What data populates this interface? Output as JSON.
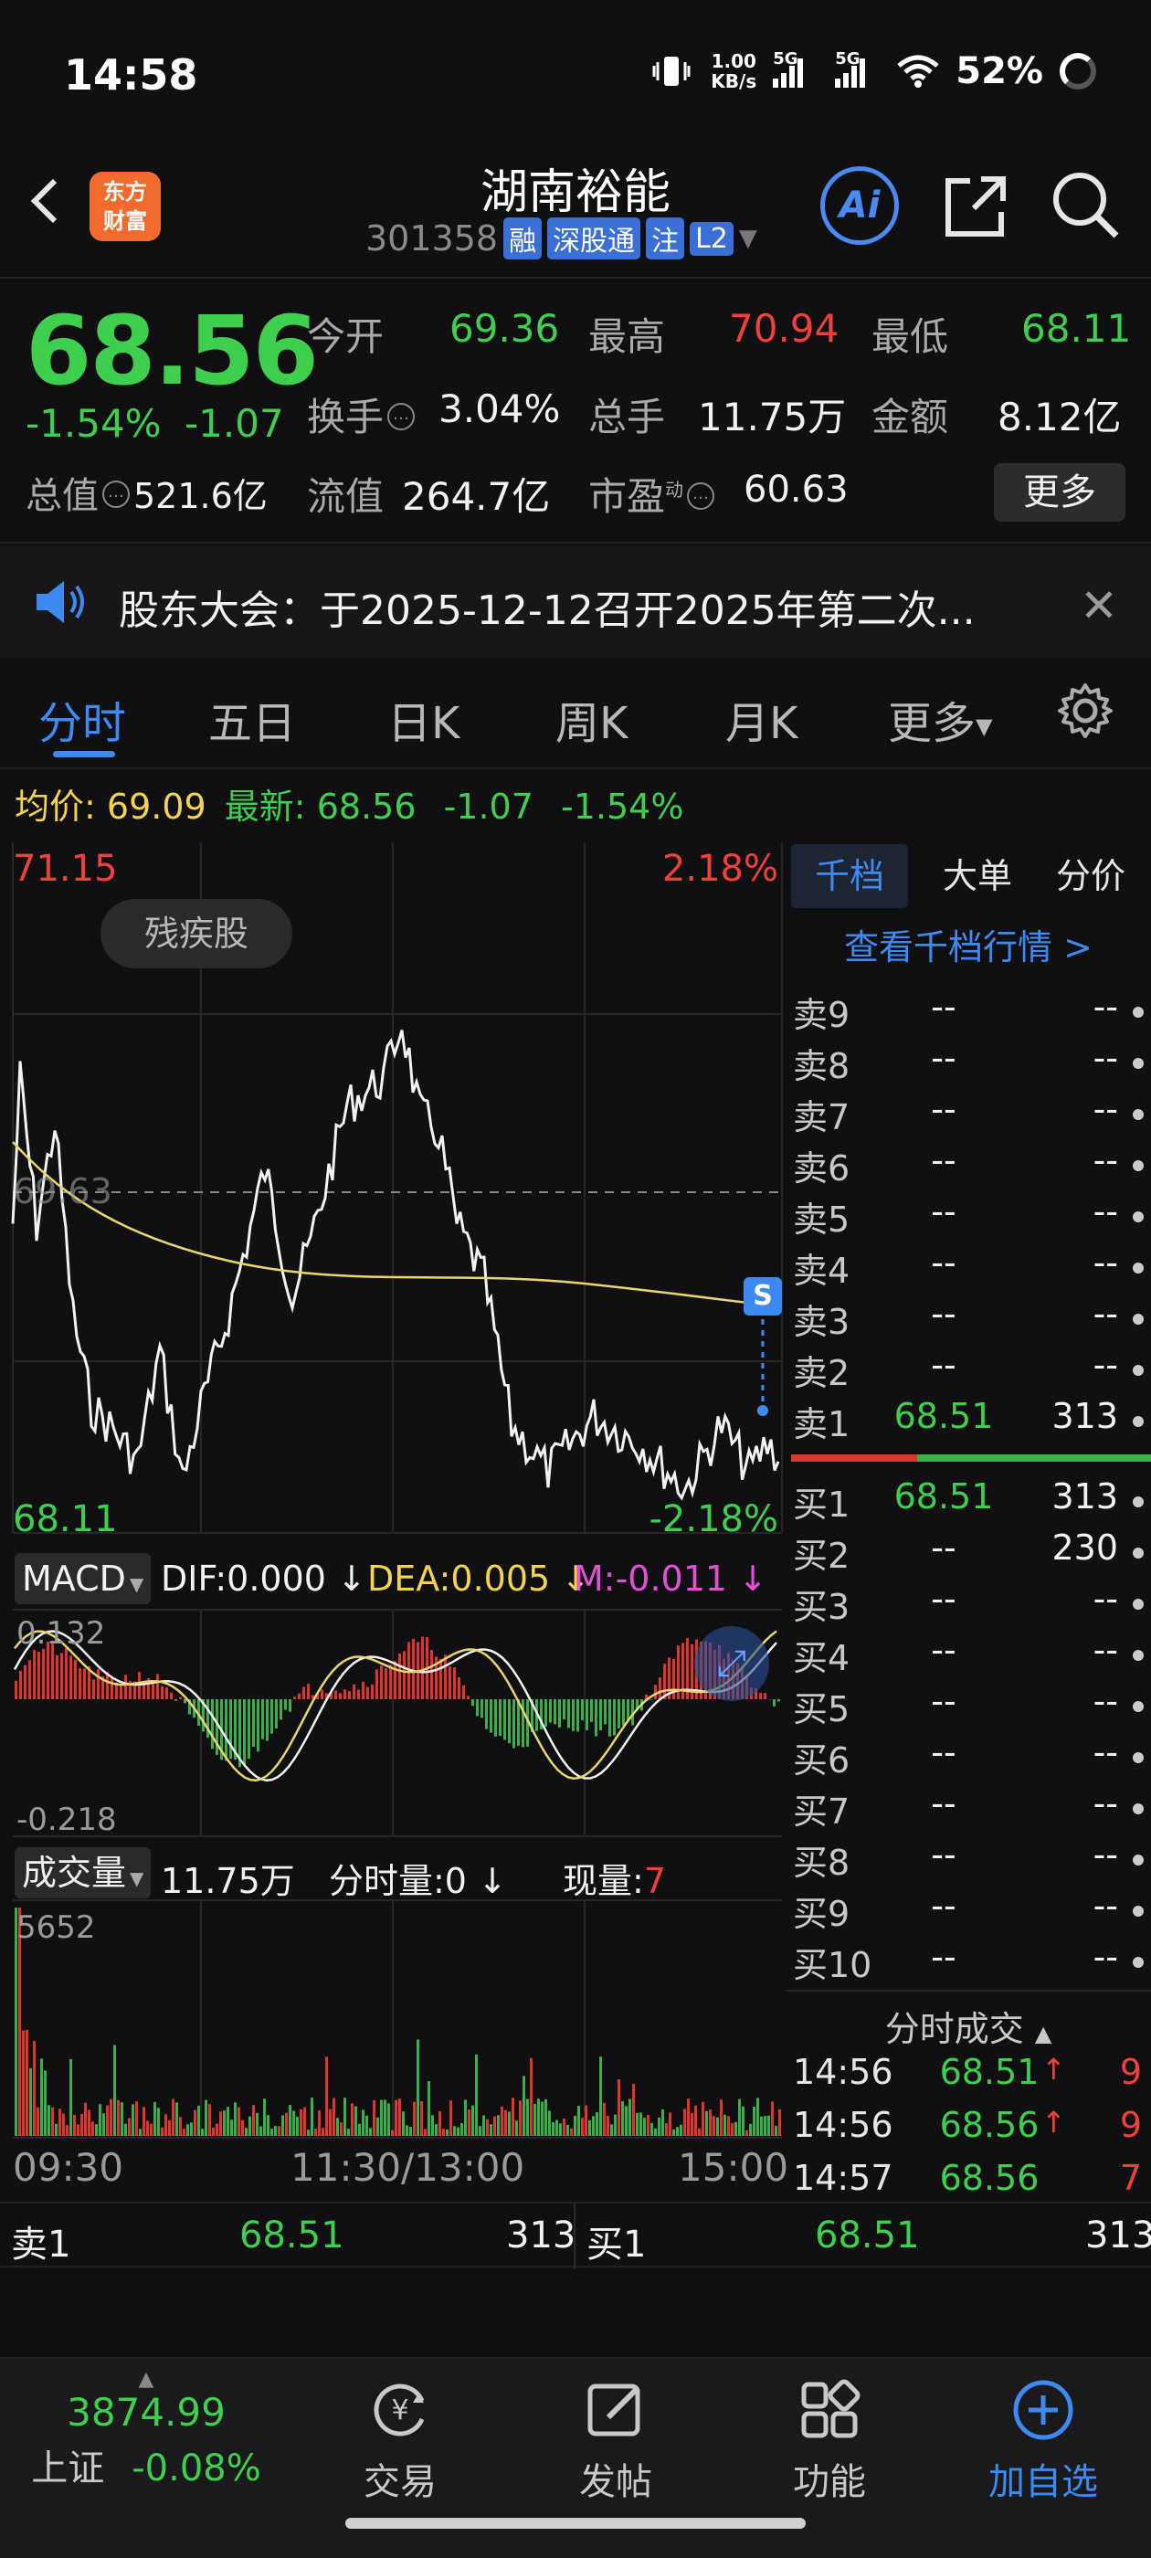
{
  "status": {
    "time": "14:58",
    "net_rate_top": "1.00",
    "net_rate_bottom": "KB/s",
    "sig1": "5G",
    "sig2": "5G",
    "battery": "52%"
  },
  "header": {
    "logo_line1": "东方",
    "logo_line2": "财富",
    "name": "湖南裕能",
    "code": "301358",
    "tags": [
      "融",
      "深股通",
      "注",
      "L2"
    ],
    "ai_label": "Ai"
  },
  "quote": {
    "price": "68.56",
    "change_pct": "-1.54%",
    "change_amt": "-1.07",
    "open_label": "今开",
    "open": "69.36",
    "high_label": "最高",
    "high": "70.94",
    "low_label": "最低",
    "low": "68.11",
    "turnover_label": "换手",
    "turnover": "3.04%",
    "volume_label": "总手",
    "volume": "11.75万",
    "amount_label": "金额",
    "amount": "8.12亿",
    "mcap_label": "总值",
    "mcap": "521.6亿",
    "float_label": "流值",
    "float_cap": "264.7亿",
    "pe_label": "市盈",
    "pe_sup": "动",
    "pe": "60.63",
    "more": "更多"
  },
  "notice": {
    "text": "股东大会：于2025-12-12召开2025年第二次..."
  },
  "tabs": [
    "分时",
    "五日",
    "日K",
    "周K",
    "月K",
    "更多"
  ],
  "avg_row": {
    "avg_label": "均价:",
    "avg": "69.09",
    "latest_label": "最新:",
    "latest": "68.56",
    "chg": "-1.07",
    "pct": "-1.54%"
  },
  "chart": {
    "y_top": "71.15",
    "y_top_pct": "2.18%",
    "y_mid": "69.63",
    "y_bottom": "68.11",
    "y_bottom_pct": "-2.18%",
    "badge": "残疾股",
    "marker": "S",
    "macd_label": "MACD",
    "dif": "DIF:0.000",
    "dea": "DEA:0.005",
    "m": "M:-0.011",
    "macd_top": "0.132",
    "macd_bottom": "-0.218",
    "vol_label": "成交量",
    "vol_total": "11.75万",
    "vol_tick_label": "分时量:0",
    "vol_now_label": "现量:",
    "vol_now": "7",
    "vol_max": "5652",
    "x_labels": [
      "09:30",
      "11:30/13:00",
      "15:00"
    ]
  },
  "orderbook": {
    "tabs": [
      "千档",
      "大单",
      "分价"
    ],
    "link": "查看千档行情 >",
    "asks": [
      {
        "label": "卖9",
        "price": "--",
        "vol": "--"
      },
      {
        "label": "卖8",
        "price": "--",
        "vol": "--"
      },
      {
        "label": "卖7",
        "price": "--",
        "vol": "--"
      },
      {
        "label": "卖6",
        "price": "--",
        "vol": "--"
      },
      {
        "label": "卖5",
        "price": "--",
        "vol": "--"
      },
      {
        "label": "卖4",
        "price": "--",
        "vol": "--"
      },
      {
        "label": "卖3",
        "price": "--",
        "vol": "--"
      },
      {
        "label": "卖2",
        "price": "--",
        "vol": "--"
      },
      {
        "label": "卖1",
        "price": "68.51",
        "vol": "313"
      }
    ],
    "bids": [
      {
        "label": "买1",
        "price": "68.51",
        "vol": "313"
      },
      {
        "label": "买2",
        "price": "--",
        "vol": "230"
      },
      {
        "label": "买3",
        "price": "--",
        "vol": "--"
      },
      {
        "label": "买4",
        "price": "--",
        "vol": "--"
      },
      {
        "label": "买5",
        "price": "--",
        "vol": "--"
      },
      {
        "label": "买6",
        "price": "--",
        "vol": "--"
      },
      {
        "label": "买7",
        "price": "--",
        "vol": "--"
      },
      {
        "label": "买8",
        "price": "--",
        "vol": "--"
      },
      {
        "label": "买9",
        "price": "--",
        "vol": "--"
      },
      {
        "label": "买10",
        "price": "--",
        "vol": "--"
      }
    ],
    "trades_title": "分时成交",
    "trades": [
      {
        "time": "14:56",
        "price": "68.51",
        "arrow": "↑",
        "vol": "9"
      },
      {
        "time": "14:56",
        "price": "68.56",
        "arrow": "↑",
        "vol": "9"
      },
      {
        "time": "14:57",
        "price": "68.56",
        "arrow": "",
        "vol": "7"
      }
    ]
  },
  "bottom_quote": {
    "ask_label": "卖1",
    "ask_price": "68.51",
    "ask_vol": "313",
    "bid_label": "买1",
    "bid_price": "68.51",
    "bid_vol": "313"
  },
  "nav": {
    "index_value": "3874.99",
    "index_name": "上证",
    "index_pct": "-0.08%",
    "items": [
      "交易",
      "发帖",
      "功能",
      "加自选"
    ]
  }
}
